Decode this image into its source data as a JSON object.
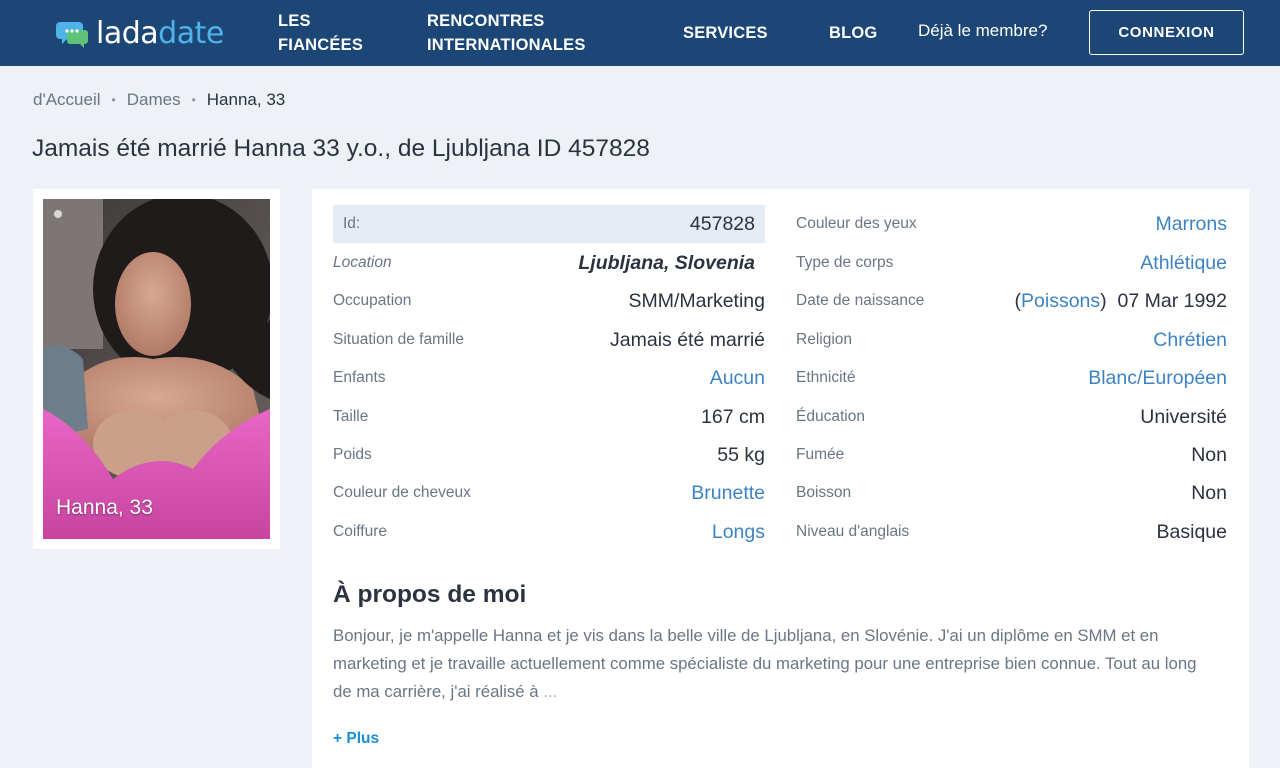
{
  "brand": {
    "logo_part1": "lada",
    "logo_part2": "date",
    "icon": "chat-bubbles-icon",
    "colors": {
      "navbar": "#1b4676",
      "accent": "#4fb3ea",
      "link": "#3d83c4",
      "plus_link": "#1a8fd6"
    }
  },
  "nav": {
    "items": [
      {
        "label": "LES\nFIANCÉES"
      },
      {
        "label": "RENCONTRES\nINTERNATIONALES"
      },
      {
        "label": "SERVICES"
      },
      {
        "label": "BLOG"
      }
    ],
    "member_text": "Déjà le membre?",
    "login_button": "CONNEXION"
  },
  "breadcrumb": {
    "items": [
      "d'Accueil",
      "Dames",
      "Hanna, 33"
    ],
    "separator": "•"
  },
  "page_title": "Jamais été marrié Hanna 33 y.o., de Ljubljana ID 457828",
  "photo": {
    "caption": "Hanna, 33",
    "alt": "profile-photo"
  },
  "details_left": [
    {
      "label": "Id:",
      "value": "457828"
    },
    {
      "label": "Location",
      "value": "Ljubljana, Slovenia"
    },
    {
      "label": "Occupation",
      "value": "SMM/Marketing"
    },
    {
      "label": "Situation de famille",
      "value": "Jamais été marrié"
    },
    {
      "label": "Enfants",
      "value": "Aucun"
    },
    {
      "label": "Taille",
      "value": "167 cm"
    },
    {
      "label": "Poids",
      "value": "55 kg"
    },
    {
      "label": "Couleur de cheveux",
      "value": "Brunette"
    },
    {
      "label": "Coiffure",
      "value": "Longs"
    }
  ],
  "details_right": [
    {
      "label": "Couleur des yeux",
      "value": "Marrons"
    },
    {
      "label": "Type de corps",
      "value": "Athlétique"
    },
    {
      "label": "Date de naissance",
      "zodiac_open": "(",
      "zodiac": "Poissons",
      "zodiac_close": ")",
      "value": "07 Mar 1992"
    },
    {
      "label": "Religion",
      "value": "Chrétien"
    },
    {
      "label": "Ethnicité",
      "value": "Blanc/Européen"
    },
    {
      "label": "Éducation",
      "value": "Université"
    },
    {
      "label": "Fumée",
      "value": "Non"
    },
    {
      "label": "Boisson",
      "value": "Non"
    },
    {
      "label": "Niveau d'anglais",
      "value": "Basique"
    }
  ],
  "about": {
    "title": "À propos de moi",
    "text": "Bonjour, je m'appelle Hanna et je vis dans la belle ville de Ljubljana, en Slovénie. J'ai un diplôme en SMM et en marketing et je travaille actuellement comme spécialiste du marketing pour une entreprise bien connue. Tout au long de ma carrière, j'ai réalisé à",
    "ellipsis": "...",
    "more_link": "+ Plus"
  }
}
